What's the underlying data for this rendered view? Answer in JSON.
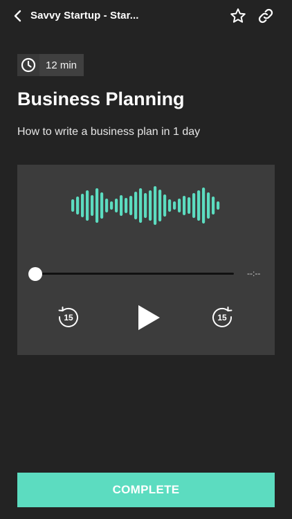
{
  "header": {
    "title": "Savvy Startup - Star...",
    "back_icon": "chevron-left-icon",
    "favorite_icon": "star-outline-icon",
    "share_icon": "link-icon"
  },
  "lesson": {
    "duration": "12 min",
    "duration_icon": "clock-icon",
    "title": "Business Planning",
    "subtitle": "How to write a business plan in 1 day"
  },
  "player": {
    "waveform_icon": "audio-waveform-icon",
    "position_fraction": 0,
    "time_display": "--:--",
    "rewind_seconds": "15",
    "forward_seconds": "15",
    "play_icon": "play-icon"
  },
  "footer": {
    "complete_label": "COMPLETE"
  },
  "colors": {
    "background": "#232323",
    "player_background": "#3c3c3c",
    "accent": "#5cdcc0",
    "text": "#ffffff"
  }
}
